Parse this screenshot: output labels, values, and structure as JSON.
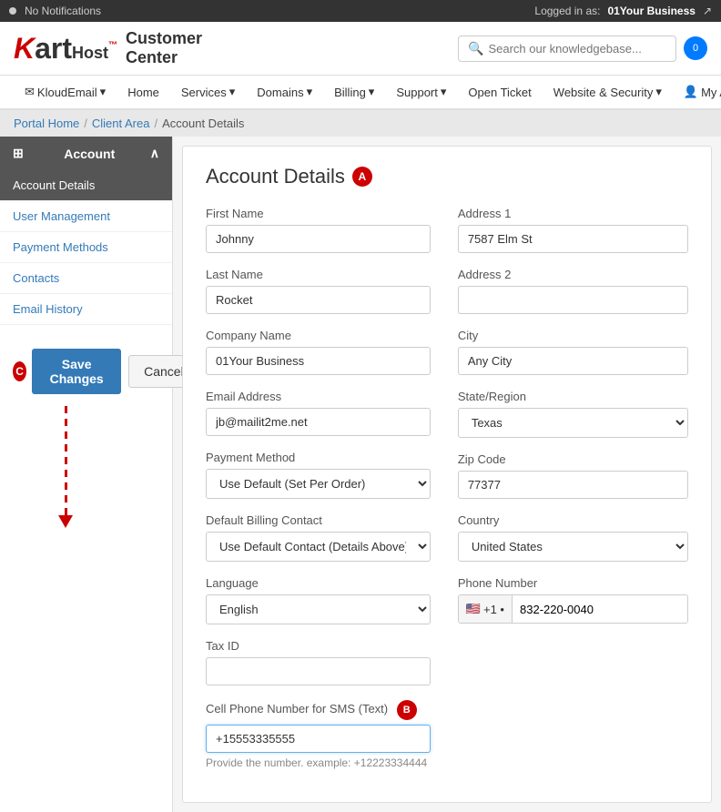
{
  "topbar": {
    "notifications": "No Notifications",
    "logged_in_as": "Logged in as:",
    "business_name": "01Your Business",
    "share_icon": "↗"
  },
  "header": {
    "logo_k": "K",
    "logo_art": "art",
    "logo_host": "Host™",
    "logo_line1": "Customer",
    "logo_line2": "Center",
    "search_placeholder": "Search our knowledgebase...",
    "cart_count": "0"
  },
  "nav": {
    "items": [
      {
        "label": "KloudEmail",
        "dropdown": true
      },
      {
        "label": "Home"
      },
      {
        "label": "Services",
        "dropdown": true
      },
      {
        "label": "Domains",
        "dropdown": true
      },
      {
        "label": "Billing",
        "dropdown": true
      },
      {
        "label": "Support",
        "dropdown": true
      },
      {
        "label": "Open Ticket"
      },
      {
        "label": "Website & Security",
        "dropdown": true
      },
      {
        "label": "My Account",
        "dropdown": true,
        "icon": true
      }
    ]
  },
  "breadcrumb": {
    "items": [
      "Portal Home",
      "Client Area",
      "Account Details"
    ]
  },
  "sidebar": {
    "header": "Account",
    "items": [
      {
        "label": "Account Details",
        "active": true
      },
      {
        "label": "User Management"
      },
      {
        "label": "Payment Methods"
      },
      {
        "label": "Contacts"
      },
      {
        "label": "Email History"
      }
    ]
  },
  "form": {
    "title": "Account Details",
    "badge_a": "A",
    "badge_b": "B",
    "badge_c": "C",
    "fields": {
      "first_name_label": "First Name",
      "first_name_value": "Johnny",
      "last_name_label": "Last Name",
      "last_name_value": "Rocket",
      "company_name_label": "Company Name",
      "company_name_value": "01Your Business",
      "email_label": "Email Address",
      "email_value": "jb@mailit2me.net",
      "payment_method_label": "Payment Method",
      "payment_method_value": "Use Default (Set Per Order)",
      "billing_contact_label": "Default Billing Contact",
      "billing_contact_value": "Use Default Contact (Details Above)",
      "language_label": "Language",
      "language_value": "English",
      "tax_id_label": "Tax ID",
      "tax_id_value": "",
      "cell_phone_label": "Cell Phone Number for SMS (Text)",
      "cell_phone_value": "+15553335555",
      "cell_phone_hint": "Provide the number. example: +12223334444",
      "address1_label": "Address 1",
      "address1_value": "7587 Elm St",
      "address2_label": "Address 2",
      "address2_value": "",
      "city_label": "City",
      "city_value": "Any City",
      "state_label": "State/Region",
      "state_value": "Texas",
      "zip_label": "Zip Code",
      "zip_value": "77377",
      "country_label": "Country",
      "country_value": "United States",
      "phone_label": "Phone Number",
      "phone_flag": "🇺🇸",
      "phone_code": "+1 •",
      "phone_number": "832-220-0040"
    },
    "save_label": "Save Changes",
    "cancel_label": "Cancel"
  }
}
